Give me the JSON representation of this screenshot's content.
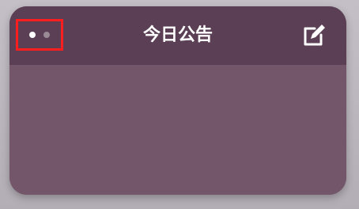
{
  "card": {
    "title": "今日公告",
    "page_indicator": {
      "pages": 2,
      "active_index": 0
    },
    "edit_icon": "edit-icon",
    "body_text": ""
  },
  "colors": {
    "header": "#5b3f55",
    "body": "#735669",
    "highlight_box": "#ff1e1e"
  }
}
